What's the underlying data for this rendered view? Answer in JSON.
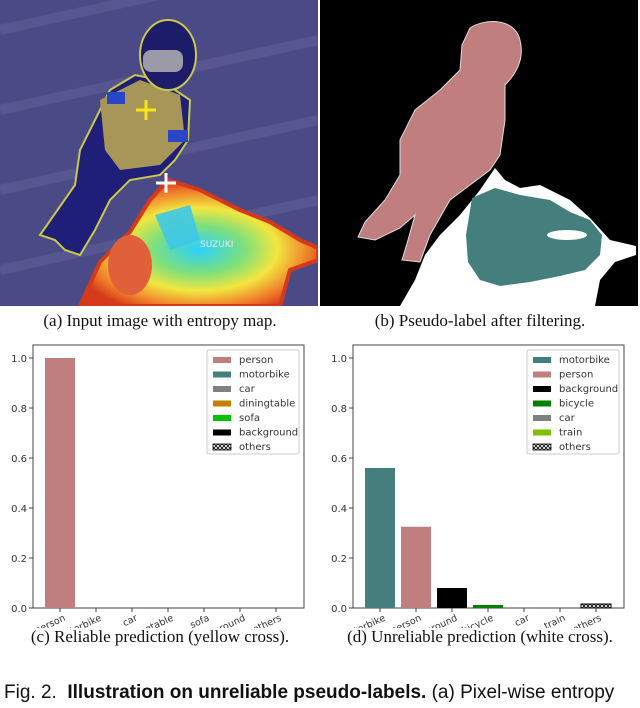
{
  "panels": {
    "a": {
      "caption": "(a) Input image with entropy map."
    },
    "b": {
      "caption": "(b) Pseudo-label after filtering."
    },
    "c": {
      "caption": "(c) Reliable prediction (yellow cross)."
    },
    "d": {
      "caption": "(d) Unreliable prediction (white cross)."
    }
  },
  "image_a": {
    "label_text": "SUZUKI",
    "markers": [
      {
        "name": "yellow-cross",
        "color": "#f5e614"
      },
      {
        "name": "white-cross",
        "color": "#ffffff"
      }
    ]
  },
  "image_b": {
    "colors": {
      "background": "#000000",
      "person": "#c07e7e",
      "motorbike": "#457f7d",
      "ignored": "#ffffff"
    }
  },
  "figure_caption": {
    "prefix": "Fig. 2.",
    "bold": "Illustration on unreliable pseudo-labels.",
    "rest": "(a) Pixel-wise entropy"
  },
  "chart_data": [
    {
      "type": "bar",
      "title": "",
      "xlabel": "",
      "ylabel": "",
      "ylim": [
        0,
        1.05
      ],
      "yticks": [
        "0.0",
        "0.2",
        "0.4",
        "0.6",
        "0.8",
        "1.0"
      ],
      "categories": [
        "person",
        "motorbike",
        "car",
        "diningtable",
        "sofa",
        "background",
        "others"
      ],
      "values": [
        1.0,
        0.0,
        0.0,
        0.0,
        0.0,
        0.0,
        0.0
      ],
      "colors": [
        "#c07e7e",
        "#457f7d",
        "#808080",
        "#c08000",
        "#00c000",
        "#000000",
        "hatch"
      ],
      "legend": {
        "position": "upper-right",
        "entries": [
          "person",
          "motorbike",
          "car",
          "diningtable",
          "sofa",
          "background",
          "others"
        ]
      },
      "grid": false
    },
    {
      "type": "bar",
      "title": "",
      "xlabel": "",
      "ylabel": "",
      "ylim": [
        0,
        1.05
      ],
      "yticks": [
        "0.0",
        "0.2",
        "0.4",
        "0.6",
        "0.8",
        "1.0"
      ],
      "categories": [
        "motorbike",
        "person",
        "background",
        "bicycle",
        "car",
        "train",
        "others"
      ],
      "values": [
        0.56,
        0.325,
        0.08,
        0.012,
        0.003,
        0.0,
        0.016
      ],
      "colors": [
        "#457f7d",
        "#c07e7e",
        "#000000",
        "#008000",
        "#808080",
        "#80c000",
        "hatch"
      ],
      "legend": {
        "position": "upper-right",
        "entries": [
          "motorbike",
          "person",
          "background",
          "bicycle",
          "car",
          "train",
          "others"
        ]
      },
      "grid": false
    }
  ]
}
